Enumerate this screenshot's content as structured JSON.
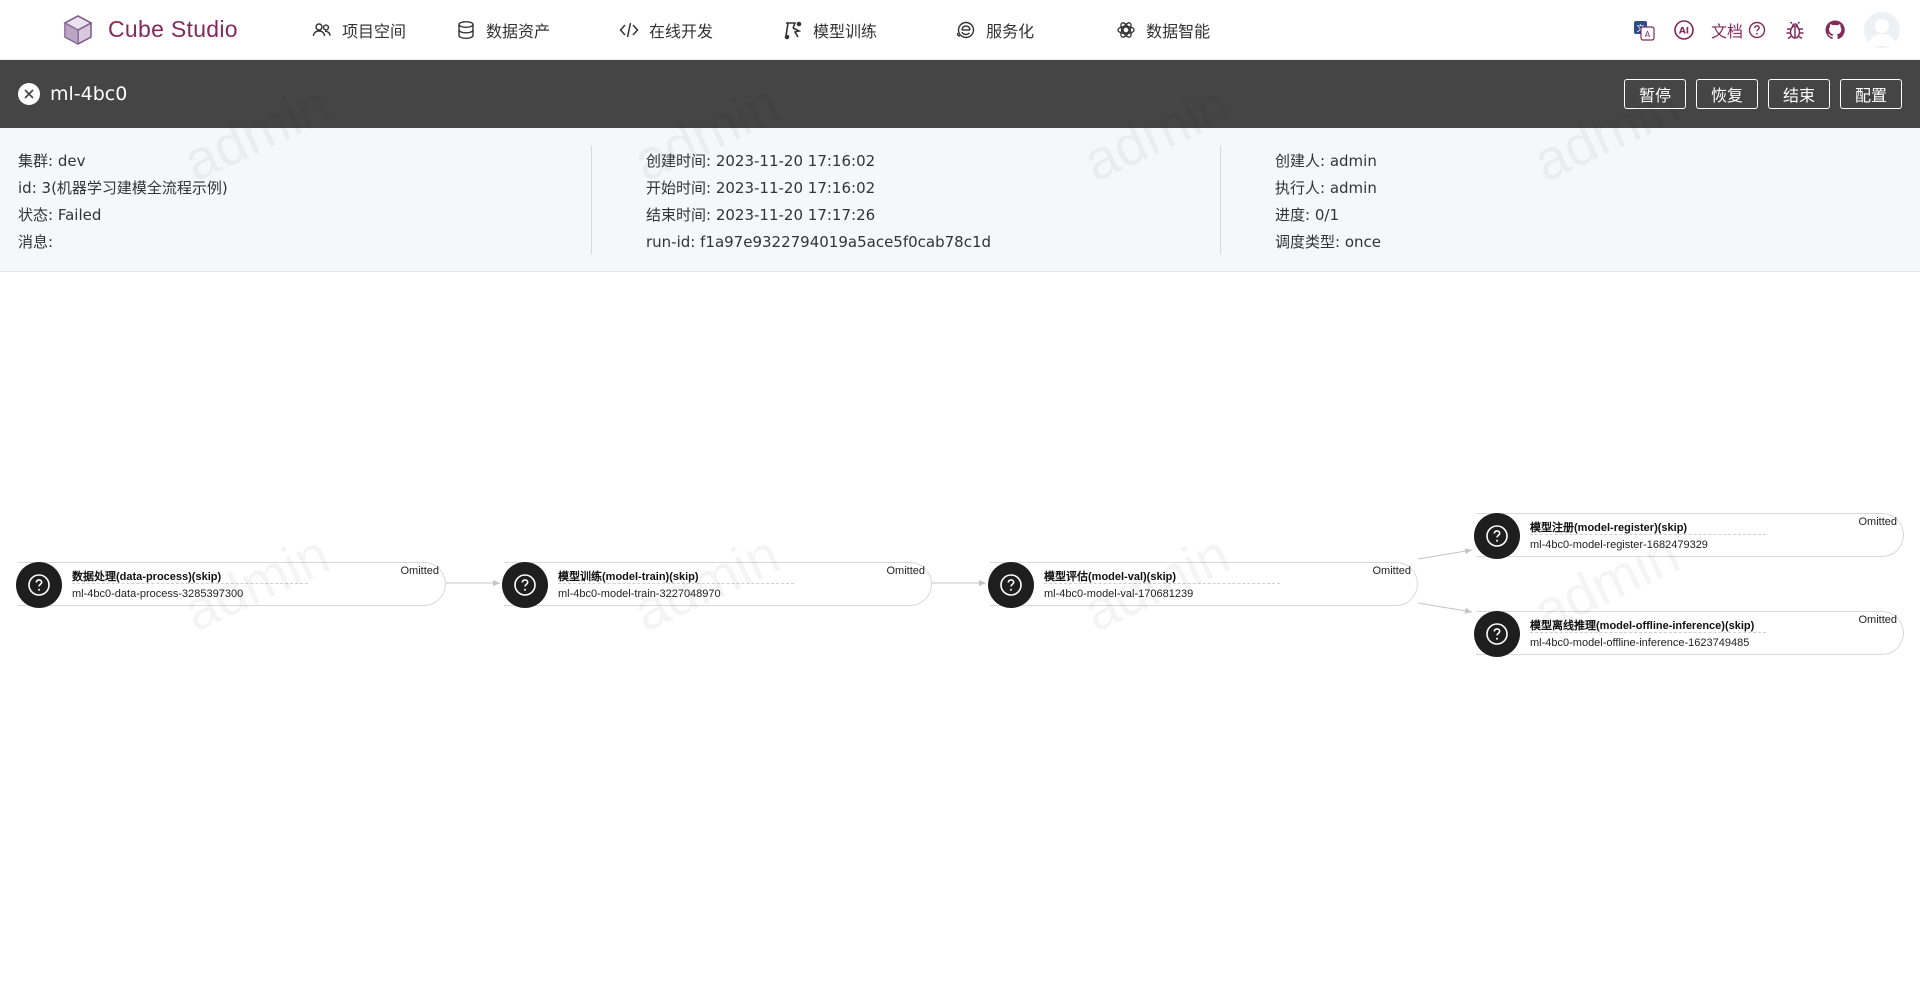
{
  "app": {
    "brand": "Cube Studio",
    "accent_color": "#822a5b",
    "nav": [
      {
        "label": "项目空间",
        "icon": "team-icon"
      },
      {
        "label": "数据资产",
        "icon": "database-icon"
      },
      {
        "label": "在线开发",
        "icon": "code-icon"
      },
      {
        "label": "模型训练",
        "icon": "training-icon"
      },
      {
        "label": "服务化",
        "icon": "service-icon"
      },
      {
        "label": "数据智能",
        "icon": "openai-icon"
      }
    ],
    "right": {
      "doc_label": "文档",
      "ai_label": "AI"
    }
  },
  "run": {
    "title": "ml-4bc0",
    "actions": [
      "暂停",
      "恢复",
      "结束",
      "配置"
    ]
  },
  "info": {
    "col1": [
      {
        "label": "集群:",
        "value": "dev"
      },
      {
        "label": "id:",
        "value": "3(机器学习建模全流程示例)"
      },
      {
        "label": "状态:",
        "value": "Failed"
      },
      {
        "label": "消息:",
        "value": ""
      }
    ],
    "col2": [
      {
        "label": "创建时间:",
        "value": "2023-11-20 17:16:02"
      },
      {
        "label": "开始时间:",
        "value": "2023-11-20 17:16:02"
      },
      {
        "label": "结束时间:",
        "value": "2023-11-20 17:17:26"
      },
      {
        "label": "run-id:",
        "value": "f1a97e9322794019a5ace5f0cab78c1d"
      }
    ],
    "col3": [
      {
        "label": "创建人:",
        "value": "admin"
      },
      {
        "label": "执行人:",
        "value": "admin"
      },
      {
        "label": "进度:",
        "value": "0/1"
      },
      {
        "label": "调度类型:",
        "value": "once"
      }
    ]
  },
  "watermark": "admin",
  "pipeline": {
    "nodes": [
      {
        "title": "数据处理(data-process)(skip)",
        "subtitle": "ml-4bc0-data-process-3285397300",
        "status": "Omitted"
      },
      {
        "title": "模型训练(model-train)(skip)",
        "subtitle": "ml-4bc0-model-train-3227048970",
        "status": "Omitted"
      },
      {
        "title": "模型评估(model-val)(skip)",
        "subtitle": "ml-4bc0-model-val-170681239",
        "status": "Omitted"
      },
      {
        "title": "模型注册(model-register)(skip)",
        "subtitle": "ml-4bc0-model-register-1682479329",
        "status": "Omitted"
      },
      {
        "title": "模型离线推理(model-offline-inference)(skip)",
        "subtitle": "ml-4bc0-model-offline-inference-1623749485",
        "status": "Omitted"
      }
    ]
  }
}
